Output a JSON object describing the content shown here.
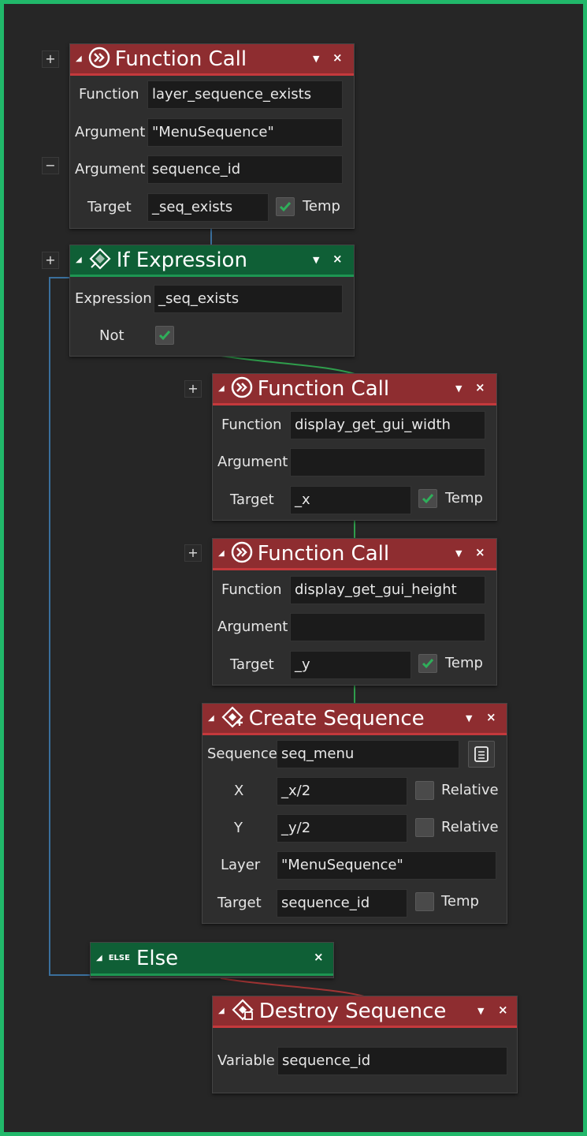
{
  "colors": {
    "accent_green": "#21b86a",
    "header_red": "#8e2d30",
    "header_green": "#0f5f36",
    "wire_blue": "#3a6f9c",
    "wire_green": "#2f9e4c",
    "wire_red": "#a03434"
  },
  "side_buttons": {
    "plus": "+",
    "minus": "−"
  },
  "header_controls": {
    "menu": "▼",
    "close": "×",
    "collapse": "◢"
  },
  "block_fc1": {
    "title": "Function Call",
    "icon": "function-call-icon",
    "function_label": "Function",
    "function_value": "layer_sequence_exists",
    "arg1_label": "Argument",
    "arg1_value": "\"MenuSequence\"",
    "arg2_label": "Argument",
    "arg2_value": "sequence_id",
    "target_label": "Target",
    "target_value": "_seq_exists",
    "temp_label": "Temp",
    "temp_checked": true
  },
  "block_if": {
    "title": "If Expression",
    "icon": "if-expression-icon",
    "expression_label": "Expression",
    "expression_value": "_seq_exists",
    "not_label": "Not",
    "not_checked": true
  },
  "block_fc2": {
    "title": "Function Call",
    "icon": "function-call-icon",
    "function_label": "Function",
    "function_value": "display_get_gui_width",
    "arg_label": "Argument",
    "arg_value": "",
    "target_label": "Target",
    "target_value": "_x",
    "temp_label": "Temp",
    "temp_checked": true
  },
  "block_fc3": {
    "title": "Function Call",
    "icon": "function-call-icon",
    "function_label": "Function",
    "function_value": "display_get_gui_height",
    "arg_label": "Argument",
    "arg_value": "",
    "target_label": "Target",
    "target_value": "_y",
    "temp_label": "Temp",
    "temp_checked": true
  },
  "block_create": {
    "title": "Create Sequence",
    "icon": "create-sequence-icon",
    "sequence_label": "Sequence",
    "sequence_value": "seq_menu",
    "x_label": "X",
    "x_value": "_x/2",
    "x_rel_label": "Relative",
    "x_rel_checked": false,
    "y_label": "Y",
    "y_value": "_y/2",
    "y_rel_label": "Relative",
    "y_rel_checked": false,
    "layer_label": "Layer",
    "layer_value": "\"MenuSequence\"",
    "target_label": "Target",
    "target_value": "sequence_id",
    "temp_label": "Temp",
    "temp_checked": false
  },
  "block_else": {
    "title": "Else",
    "icon_text": "ELSE"
  },
  "block_destroy": {
    "title": "Destroy Sequence",
    "icon": "destroy-sequence-icon",
    "variable_label": "Variable",
    "variable_value": "sequence_id"
  }
}
